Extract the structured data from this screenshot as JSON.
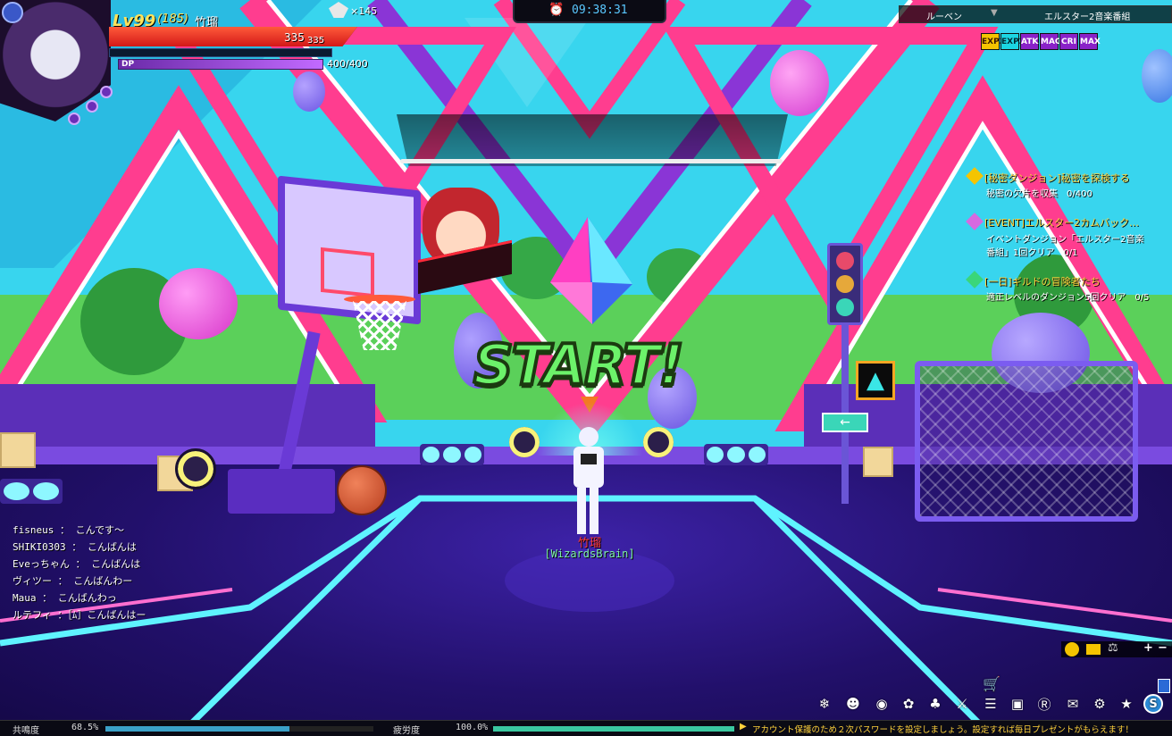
{
  "player": {
    "level": "Lv99",
    "sub_level": "(185)",
    "name": "竹瑠",
    "hp_current": "335",
    "hp_max": "335",
    "hp_fraction": 1.0,
    "mp_fraction": 0.0,
    "dp_label": "DP",
    "dp_value": "400/400",
    "dp_fraction": 1.0,
    "lives": "×145",
    "guild": "[WizardsBrain]"
  },
  "clock": {
    "time": "09:38:31"
  },
  "location": {
    "town": "ルーベン",
    "channel": "エルスター2音楽番組"
  },
  "buffs": [
    {
      "label": "EXP3",
      "bg": "#f5c400",
      "fg": "#3a1800"
    },
    {
      "label": "EXP2",
      "bg": "#1bd6e3",
      "fg": "#002a34"
    },
    {
      "label": "ATK",
      "bg": "#8a22c8",
      "fg": "#ffffff"
    },
    {
      "label": "MAG",
      "bg": "#8a22c8",
      "fg": "#ffffff"
    },
    {
      "label": "CRI",
      "bg": "#8a22c8",
      "fg": "#ffffff"
    },
    {
      "label": "MAX",
      "bg": "#8a22c8",
      "fg": "#ffffff"
    }
  ],
  "quests": [
    {
      "title": "[秘密ダンジョン]秘密を探検する",
      "lines": [
        "秘密の欠片を収集　0/400"
      ]
    },
    {
      "title": "[EVENT]エルスター2カムバック…",
      "lines": [
        "イベントダンジョン「エルスター2音楽",
        "番組」1回クリア　0/1"
      ]
    },
    {
      "title": "[一日]ギルドの冒険者たち",
      "lines": [
        "適正レベルのダンジョン5回クリア　0/5"
      ]
    }
  ],
  "chat": [
    {
      "text": "fisneus ： こんです～"
    },
    {
      "text": "SHIKI0303 ： こんばんは"
    },
    {
      "text": "Eveっちゃん ： こんばんは"
    },
    {
      "text": "ヴィツー ： こんばんわー"
    },
    {
      "text": "Maua ： こんばんわっ"
    },
    {
      "text": "ルテフィ ：［ﾑ］こんばんはー"
    }
  ],
  "start_text": "START!",
  "bottom": {
    "resonance_label": "共鳴度",
    "resonance_value": "68.5%",
    "resonance_fraction": 0.685,
    "fatigue_label": "疲労度",
    "fatigue_value": "100.0%",
    "fatigue_fraction": 1.0,
    "notice": "アカウント保護のため２次パスワードを設定しましょう。設定すれば毎日プレゼントがもらえます！"
  },
  "zoom": {
    "plus": "+",
    "minus": "−"
  },
  "colors": {
    "hp": "#e8231e",
    "dp": "#9a3fe0",
    "accent_pink": "#ff3d8f",
    "accent_cyan": "#5ff3ff",
    "start_green": "#3dd94a",
    "quest_gold": "#ffd23c"
  },
  "icons": [
    "ninja-icon",
    "character-icon",
    "inventory-bag-icon",
    "skill-leaf-icon",
    "pet-icon",
    "weapon-icon",
    "cash-shop-icon",
    "quest-scroll-icon",
    "box-icon",
    "guild-g-icon",
    "community-icon",
    "settings-gear-icon",
    "event-gift-icon",
    "s-menu-icon"
  ]
}
